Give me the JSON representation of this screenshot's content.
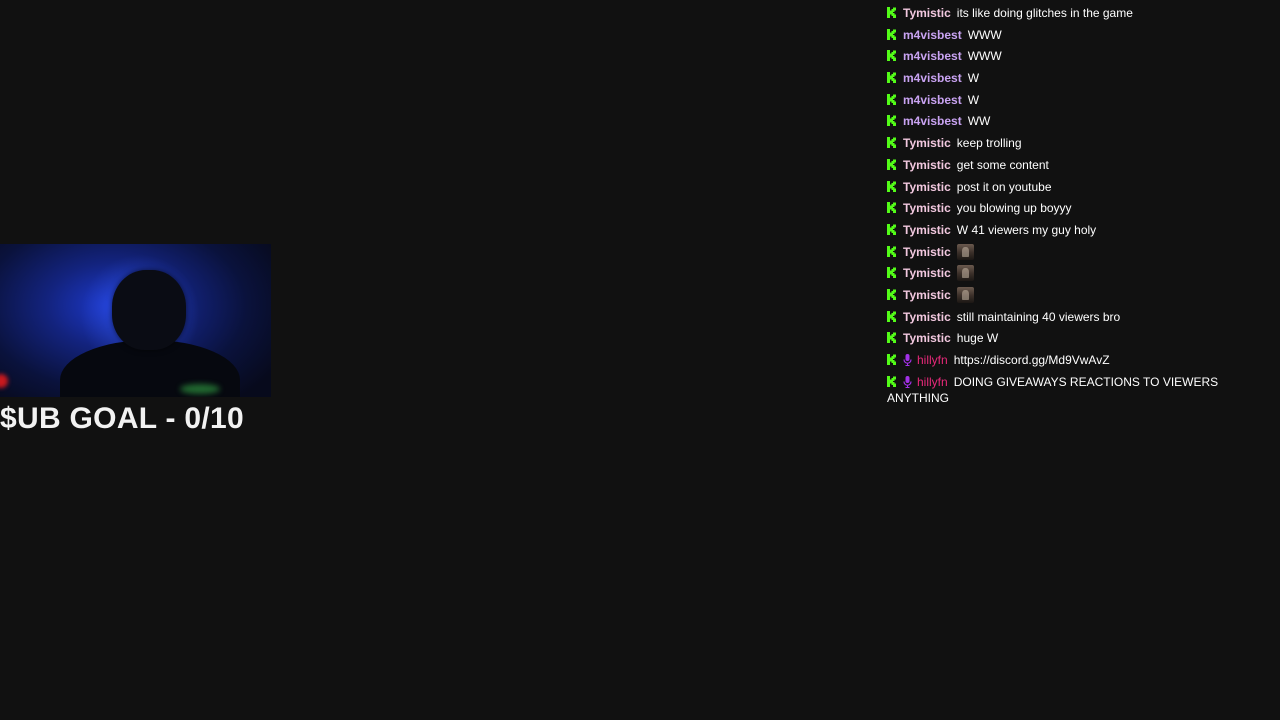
{
  "overlay": {
    "sub_goal_text": "$UB GOAL - 0/10"
  },
  "colors": {
    "background": "#111111",
    "kick_badge": "#53fc18",
    "user_tymistic": "#f2c8df",
    "user_m4visbest": "#c9a3f2",
    "user_hillyfn": "#e8297a",
    "mic_badge": "#a231e8"
  },
  "chat": {
    "messages": [
      {
        "user": "Tymistic",
        "text": "its like doing glitches in the game"
      },
      {
        "user": "m4visbest",
        "text": "WWW"
      },
      {
        "user": "m4visbest",
        "text": "WWW"
      },
      {
        "user": "m4visbest",
        "text": "W"
      },
      {
        "user": "m4visbest",
        "text": "W"
      },
      {
        "user": "m4visbest",
        "text": "WW"
      },
      {
        "user": "Tymistic",
        "text": "keep trolling"
      },
      {
        "user": "Tymistic",
        "text": "get some content"
      },
      {
        "user": "Tymistic",
        "text": "post it on youtube"
      },
      {
        "user": "Tymistic",
        "text": "you blowing up boyyy"
      },
      {
        "user": "Tymistic",
        "text": "W 41 viewers my guy holy"
      },
      {
        "user": "Tymistic",
        "text": ""
      },
      {
        "user": "Tymistic",
        "text": ""
      },
      {
        "user": "Tymistic",
        "text": ""
      },
      {
        "user": "Tymistic",
        "text": "still maintaining 40 viewers bro"
      },
      {
        "user": "Tymistic",
        "text": "huge W"
      },
      {
        "user": "hillyfn",
        "text": "https://discord.gg/Md9VwAvZ"
      },
      {
        "user": "hillyfn",
        "text": "DOING GIVEAWAYS REACTIONS TO VIEWERS ANYTHING"
      }
    ]
  }
}
